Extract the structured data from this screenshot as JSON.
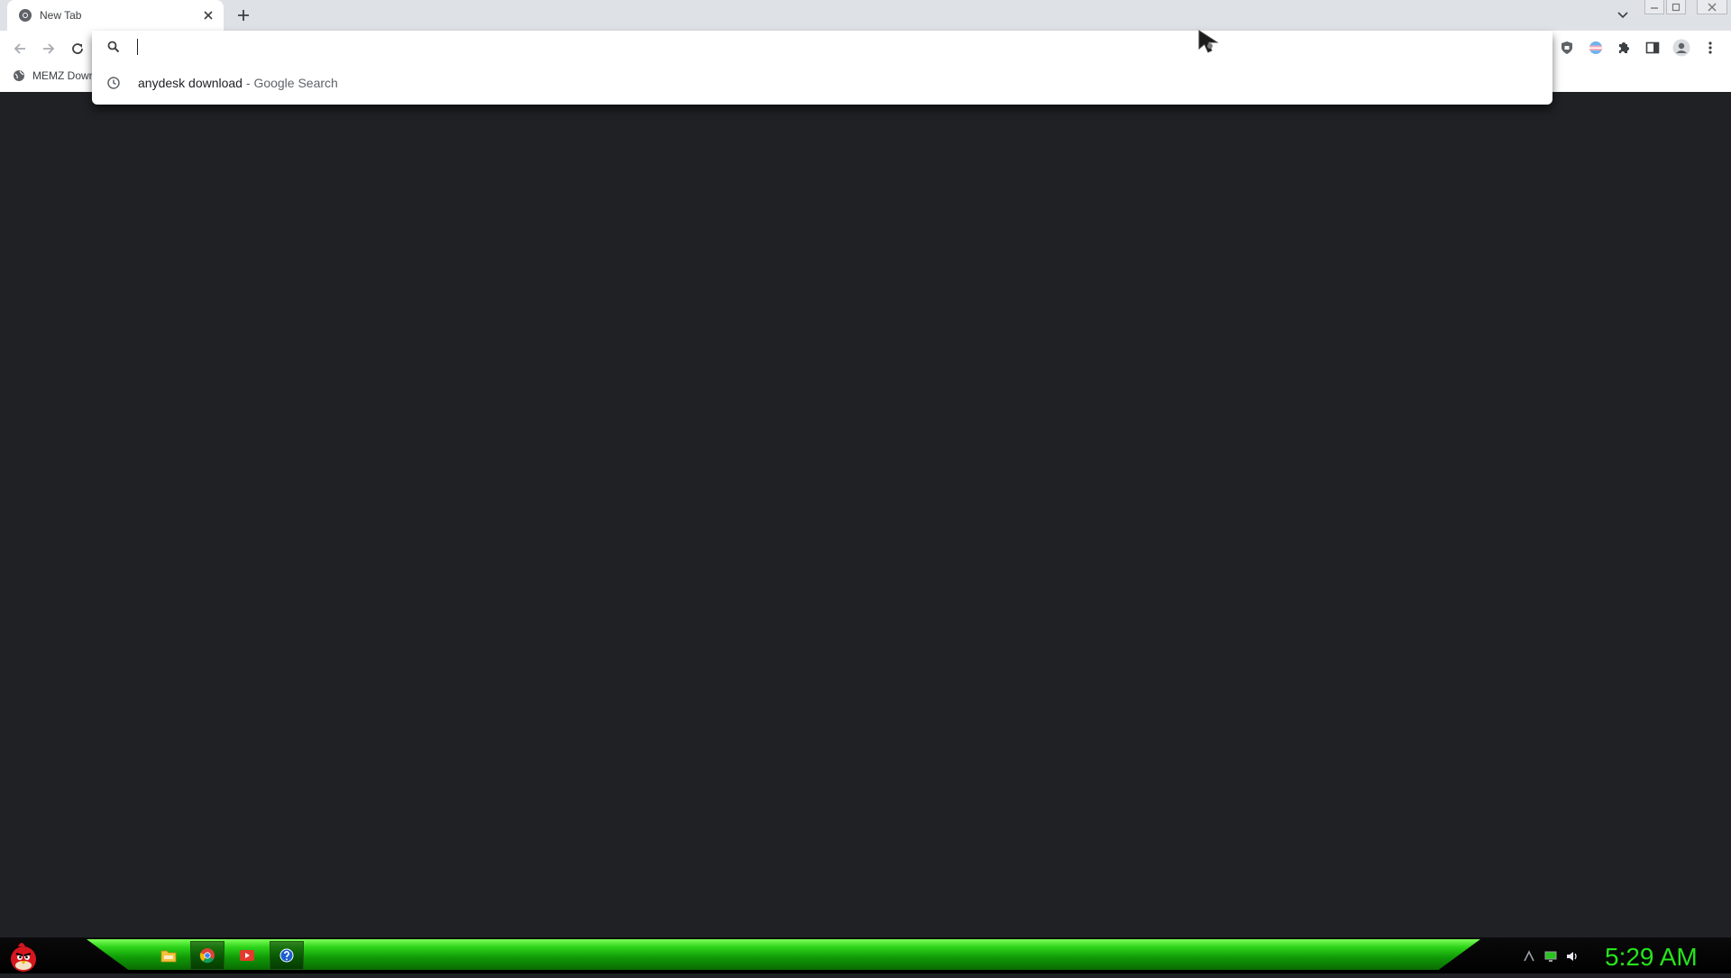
{
  "browser": {
    "tab": {
      "title": "New Tab",
      "favicon": "chrome-icon",
      "close_icon": "close-icon"
    },
    "new_tab_icon": "plus-icon",
    "tab_search_icon": "chevron-down-icon",
    "window_controls": [
      "minimize-icon",
      "maximize-icon",
      "close-icon"
    ]
  },
  "toolbar": {
    "nav": [
      "back-arrow-icon",
      "forward-arrow-icon",
      "reload-icon"
    ],
    "bookmark": {
      "label": "MEMZ Down",
      "icon": "globe-icon"
    },
    "extensions": [
      "shield-extension-icon",
      "flag-extension-icon",
      "puzzle-icon",
      "side-panel-icon",
      "profile-icon",
      "more-menu-icon"
    ]
  },
  "omnibox": {
    "value": "",
    "placeholder": "",
    "suggestion": {
      "query": "anydesk download",
      "separator": "-",
      "description": "Google Search",
      "icon": "history-clock-icon"
    }
  },
  "taskbar": {
    "start_icon": "angry-bird-start-icon",
    "items": [
      "file-explorer-icon",
      "chrome-icon",
      "media-player-icon",
      "help-icon"
    ],
    "tray": [
      "network-icon",
      "display-icon",
      "volume-icon"
    ],
    "clock": "5:29 AM",
    "accent_color": "#27e41c"
  },
  "colors": {
    "page_background": "#202124",
    "tabstrip": "#dee1e6"
  }
}
